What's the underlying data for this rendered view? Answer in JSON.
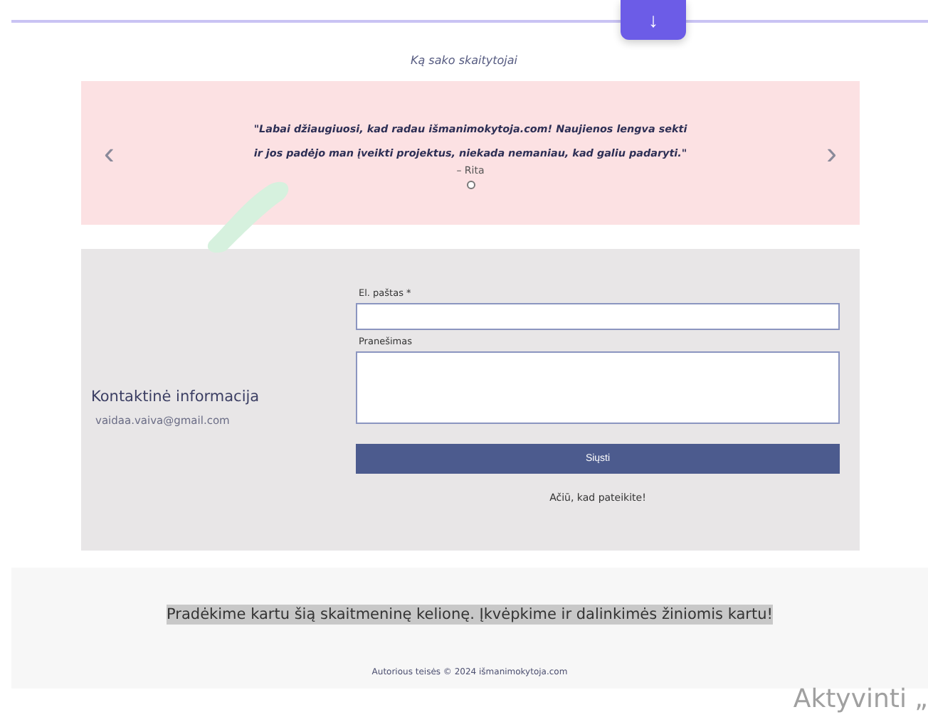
{
  "scroll_button": {
    "label": "↓"
  },
  "testimonials": {
    "heading": "Ką sako skaitytojai",
    "quote": "\"Labai džiaugiuosi, kad radau išmanimokytoja.com! Naujienos lengva sekti ir jos padėjo man įveikti projektus, niekada nemaniau, kad galiu padaryti.\"",
    "author": "– Rita",
    "prev": "‹",
    "next": "›",
    "dots": [
      {
        "selected": true
      }
    ]
  },
  "contact": {
    "title": "Kontaktinė informacija",
    "email": "vaidaa.vaiva@gmail.com",
    "fields": [
      {
        "kind": "input",
        "label": "El. paštas *"
      },
      {
        "kind": "textarea",
        "label": "Pranešimas"
      }
    ],
    "submit": "Siųsti",
    "thanks": "Ačiū, kad pateikite!"
  },
  "footer": {
    "slogan": "Pradėkime kartu šią skaitmeninę kelionę. Įkvėpkime ir dalinkimės žiniomis kartu!",
    "copyright": "Autorious teisės © 2024 išmanimokytoja.com"
  },
  "os_overlay": "Aktyvinti „"
}
